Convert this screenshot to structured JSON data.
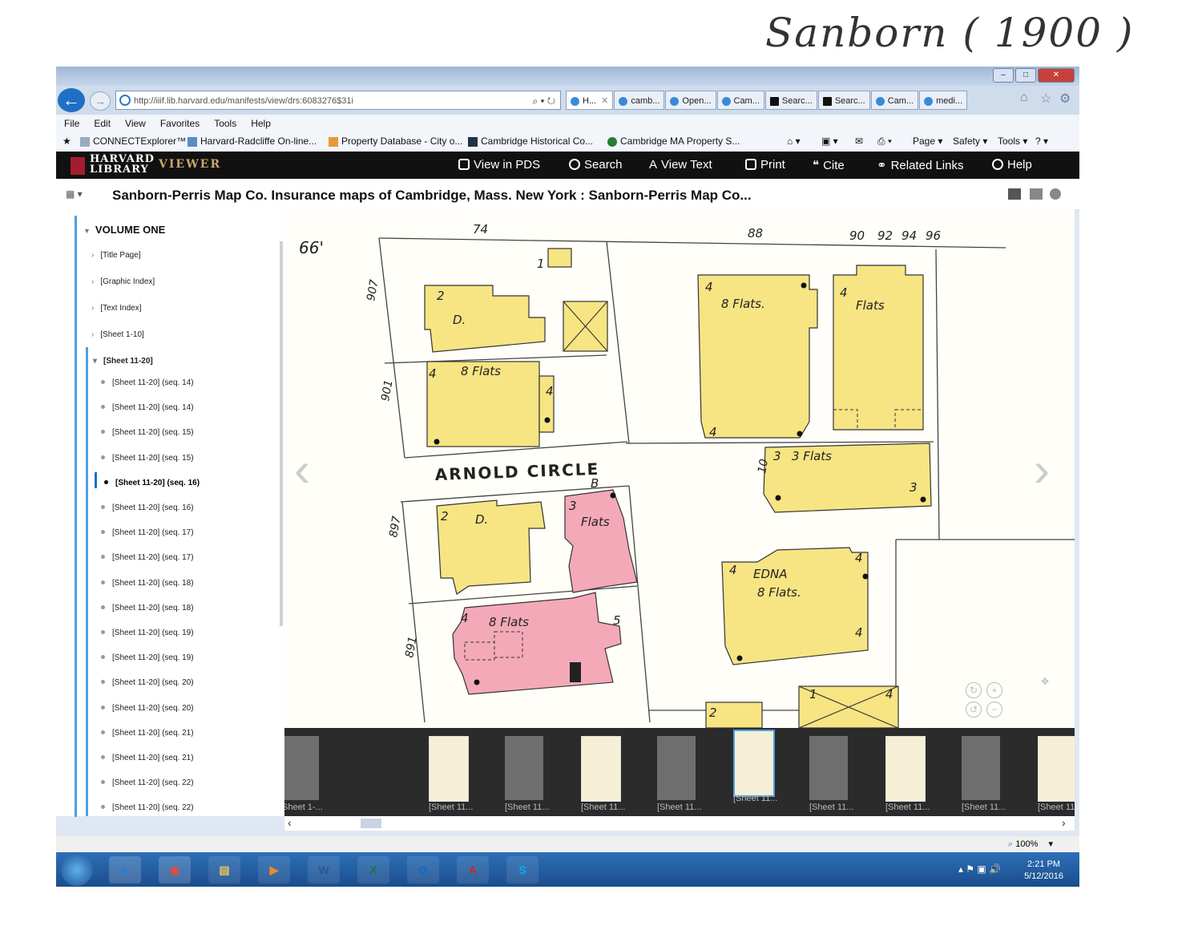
{
  "handwritten_note": "Sanborn ( 1900 )",
  "browser": {
    "window_buttons": [
      "–",
      "□",
      "✕"
    ],
    "address": "http://iiif.lib.harvard.edu/manifests/view/drs:6083276$31i",
    "address_controls": "⌕ ▾ ↻",
    "tabs": [
      "H...",
      "camb...",
      "Open...",
      "Cam...",
      "Searc...",
      "Searc...",
      "Cam...",
      "medi..."
    ],
    "menu": [
      "File",
      "Edit",
      "View",
      "Favorites",
      "Tools",
      "Help"
    ],
    "favorites": [
      "CONNECTExplorer™",
      "Harvard-Radcliffe On-line...",
      "Property Database - City o...",
      "Cambridge Historical Co...",
      "Cambridge MA Property S..."
    ],
    "commands": [
      "Page ▾",
      "Safety ▾",
      "Tools ▾"
    ]
  },
  "viewer": {
    "logo_line1": "HARVARD",
    "logo_line2": "LIBRARY",
    "viewer_word": "VIEWER",
    "nav": [
      "View in PDS",
      "Search",
      "View Text",
      "Print",
      "Cite",
      "Related Links",
      "Help"
    ],
    "doc_title": "Sanborn-Perris Map Co. Insurance maps of Cambridge, Mass. New York : Sanborn-Perris Map Co..."
  },
  "sidebar": {
    "volume": "VOLUME ONE",
    "top_items": [
      "[Title Page]",
      "[Graphic Index]",
      "[Text Index]",
      "[Sheet 1-10]",
      "[Sheet 11-20]"
    ],
    "sub_items": [
      "[Sheet 11-20] (seq. 14)",
      "[Sheet 11-20] (seq. 14)",
      "[Sheet 11-20] (seq. 15)",
      "[Sheet 11-20] (seq. 15)",
      "[Sheet 11-20] (seq. 16)",
      "[Sheet 11-20] (seq. 16)",
      "[Sheet 11-20] (seq. 17)",
      "[Sheet 11-20] (seq. 17)",
      "[Sheet 11-20] (seq. 18)",
      "[Sheet 11-20] (seq. 18)",
      "[Sheet 11-20] (seq. 19)",
      "[Sheet 11-20] (seq. 19)",
      "[Sheet 11-20] (seq. 20)",
      "[Sheet 11-20] (seq. 20)",
      "[Sheet 11-20] (seq. 21)",
      "[Sheet 11-20] (seq. 21)",
      "[Sheet 11-20] (seq. 22)",
      "[Sheet 11-20] (seq. 22)"
    ],
    "current_index": 4
  },
  "map": {
    "street": "ARNOLD   CIRCLE",
    "top_numbers": [
      "74",
      "88",
      "90",
      "92",
      "94",
      "96"
    ],
    "corner_number": "66'",
    "lot_numbers": [
      "907",
      "901",
      "897",
      "891",
      "10"
    ],
    "labels": [
      "D.",
      "D.",
      "8 Flats",
      "8 Flats.",
      "Flats",
      "3 Flats",
      "Flats",
      "EDNA",
      "8 Flats.",
      "8 Flats"
    ],
    "story_marks": [
      "2",
      "4",
      "4",
      "4",
      "4",
      "4",
      "3",
      "3",
      "2",
      "3",
      "4",
      "4",
      "4",
      "4",
      "5",
      "2",
      "1",
      "1",
      "4",
      "B"
    ]
  },
  "filmstrip": {
    "labels": [
      "Sheet 1-...",
      "[Sheet 11...",
      "[Sheet 11...",
      "[Sheet 11...",
      "[Sheet 11...",
      "[Sheet 11...",
      "[Sheet 11...",
      "[Sheet 11...",
      "[Sheet 11...",
      "[Sheet 11...",
      "[Sheet 1"
    ],
    "selected_index": 5
  },
  "status": {
    "zoom": "100%"
  },
  "taskbar": {
    "apps": [
      "e",
      "◉",
      "▤",
      "▶",
      "W",
      "X",
      "O",
      "A",
      "S"
    ],
    "time": "2:21 PM",
    "date": "5/12/2016"
  },
  "colors": {
    "dwelling": "#f7e483",
    "brick": "#f4a9b8",
    "accent": "#4aa0e6",
    "harvard": "#a51c30"
  }
}
